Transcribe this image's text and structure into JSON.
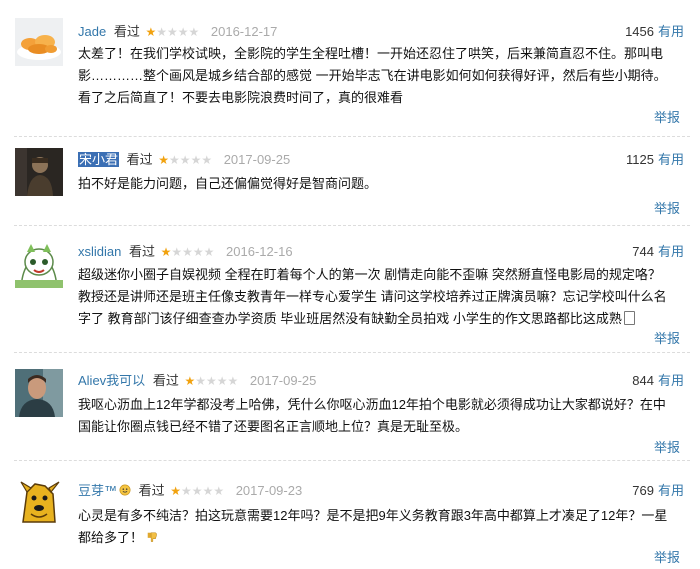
{
  "reviews": [
    {
      "user": "Jade",
      "action": "看过",
      "date": "2016-12-17",
      "count": "1456",
      "useful": "有用",
      "rating": 1,
      "text": "太差了！在我们学校试映，全影院的学生全程吐槽！一开始还忍住了哄笑，后来兼简直忍不住。那叫电影…………整个画风是城乡结合部的感觉 一开始毕志飞在讲电影如何如何获得好评，然后有些小期待。看了之后简直了！不要去电影院浪费时间了，真的很难看",
      "report": "举报",
      "avatar": "orange-food-photo"
    },
    {
      "user": "宋小君",
      "action": "看过",
      "date": "2017-09-25",
      "count": "1125",
      "useful": "有用",
      "rating": 1,
      "text": "拍不好是能力问题，自己还偏偏觉得好是智商问题。",
      "report": "举报",
      "avatar": "dark-portrait-photo"
    },
    {
      "user": "xslidian",
      "action": "看过",
      "date": "2016-12-16",
      "count": "744",
      "useful": "有用",
      "rating": 1,
      "text": "超级迷你小圈子自娱视频 全程在盯着每个人的第一次 剧情走向能不歪嘛 突然掰直怪电影局的规定咯？ 教授还是讲师还是班主任像支教青年一样专心爱学生 请问这学校培养过正牌演员嘛？忘记学校叫什么名字了 教育部门该仔细查查办学资质 毕业班居然没有缺勤全员拍戏 小学生的作文思路都比这成熟",
      "report": "举报",
      "avatar": "green-cartoon-character"
    },
    {
      "user": "Aliev我可以",
      "action": "看过",
      "date": "2017-09-25",
      "count": "844",
      "useful": "有用",
      "rating": 1,
      "text": "我呕心沥血上12年学都没考上哈佛，凭什么你呕心沥血12年拍个电影就必须得成功让大家都说好？在中国能让你圈点钱已经不错了还要图名正言顺地上位？真是无耻至极。",
      "report": "举报",
      "avatar": "man-portrait-photo"
    },
    {
      "user": "豆芽™",
      "action": "看过",
      "date": "2017-09-23",
      "count": "769",
      "useful": "有用",
      "rating": 1,
      "text": "心灵是有多不纯洁？拍这玩意需要12年吗？是不是把9年义务教育跟3年高中都算上才凑足了12年？一星都给多了！",
      "report": "举报",
      "avatar": "yellow-dog-cartoon"
    }
  ],
  "colors": {
    "link": "#3377aa",
    "star": "#f1a20f",
    "date": "#aaaaaa"
  }
}
